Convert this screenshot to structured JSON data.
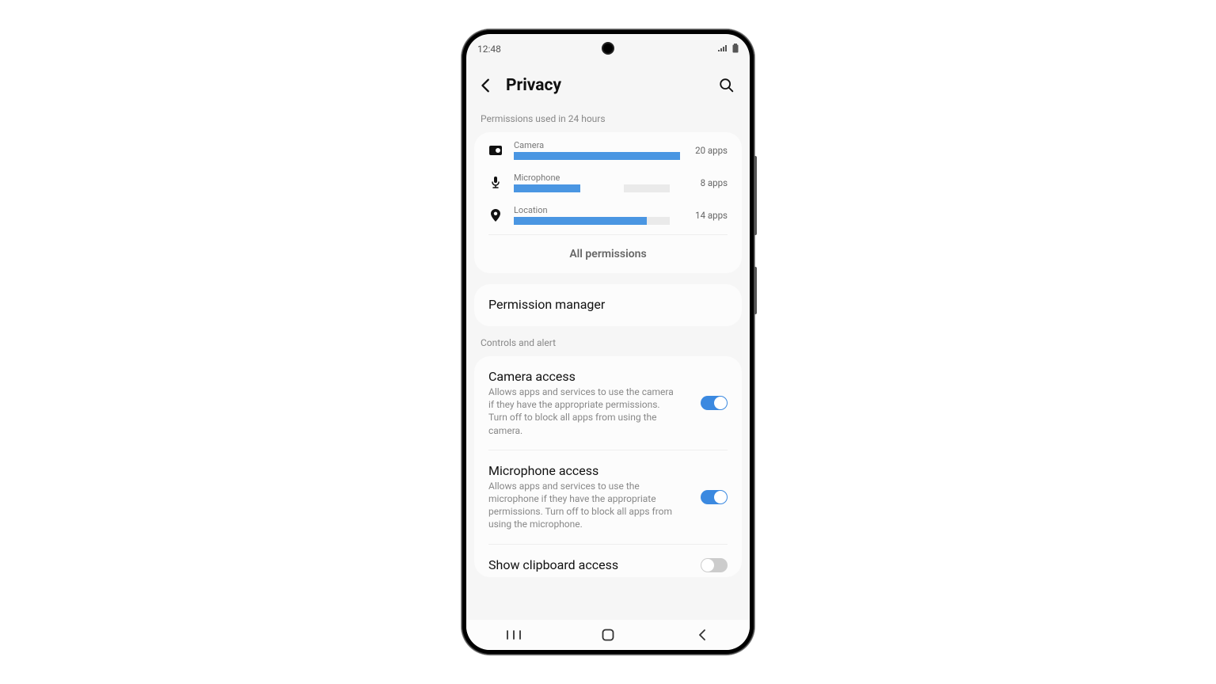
{
  "status_bar": {
    "time": "12:48"
  },
  "header": {
    "title": "Privacy"
  },
  "usage": {
    "caption": "Permissions used in 24 hours",
    "rows": [
      {
        "label": "Camera",
        "count": "20 apps",
        "bar_pct": 100
      },
      {
        "label": "Microphone",
        "count": "8 apps",
        "bar_pct": 40
      },
      {
        "label": "Location",
        "count": "14 apps",
        "bar_pct": 80
      }
    ],
    "all_permissions": "All permissions"
  },
  "permission_manager": {
    "title": "Permission manager"
  },
  "controls": {
    "caption": "Controls and alert",
    "camera": {
      "title": "Camera access",
      "desc": "Allows apps and services to use the camera if they have the appropriate permissions. Turn off to block all apps from using the camera.",
      "on": true
    },
    "microphone": {
      "title": "Microphone access",
      "desc": "Allows apps and services to use the microphone if they have the appropriate permissions. Turn off to block all apps from using the microphone.",
      "on": true
    },
    "clipboard": {
      "title": "Show clipboard access",
      "on": false
    }
  },
  "chart_data": {
    "type": "bar",
    "title": "Permissions used in 24 hours",
    "categories": [
      "Camera",
      "Microphone",
      "Location"
    ],
    "values": [
      20,
      8,
      14
    ],
    "xlabel": "",
    "ylabel": "apps",
    "ylim": [
      0,
      20
    ]
  }
}
